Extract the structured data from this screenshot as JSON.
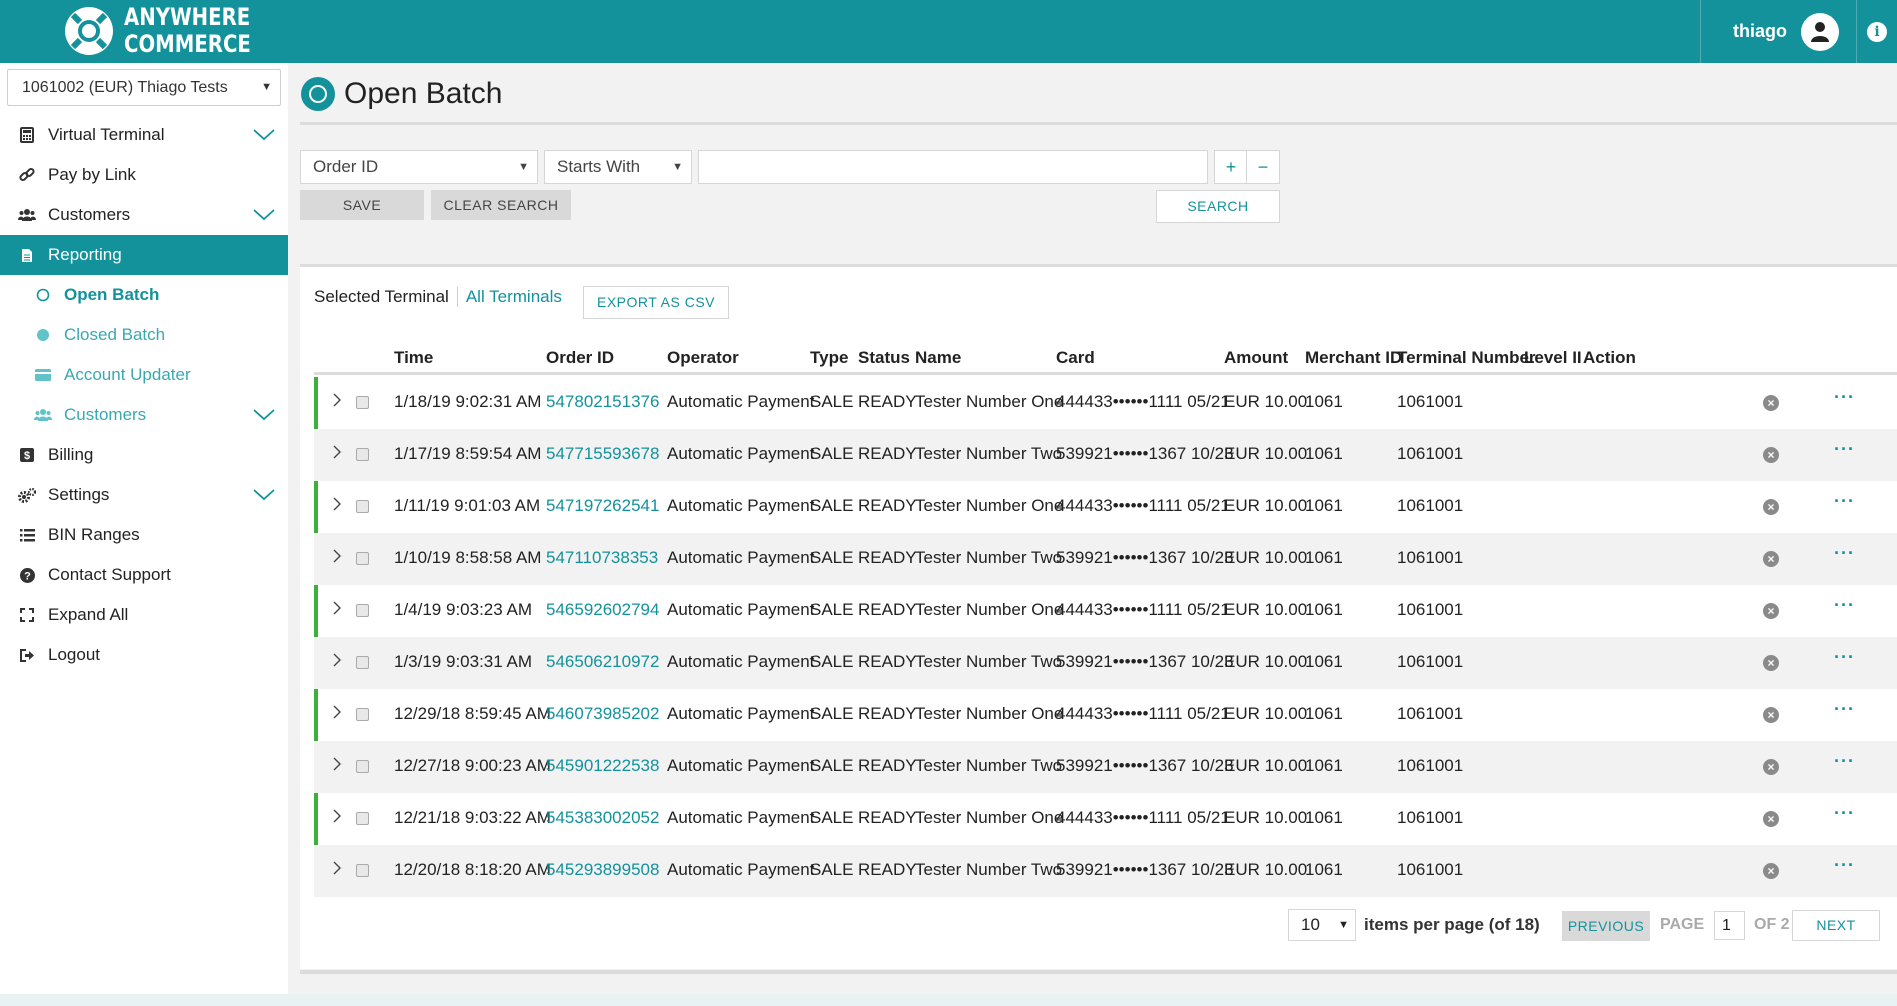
{
  "header": {
    "brand_line1": "ANYWHERE",
    "brand_line2": "COMMERCE",
    "user_name": "thiago",
    "info_icon": "info-icon",
    "colors": {
      "primary": "#13929c"
    }
  },
  "sidebar": {
    "merchant": "1061002 (EUR) Thiago Tests",
    "items": [
      {
        "label": "Virtual Terminal",
        "icon": "calculator-icon"
      },
      {
        "label": "Pay by Link",
        "icon": "link-icon"
      },
      {
        "label": "Customers",
        "icon": "users-icon"
      },
      {
        "label": "Reporting",
        "icon": "document-icon"
      },
      {
        "label": "Open Batch",
        "icon": "circle-outline-icon"
      },
      {
        "label": "Closed Batch",
        "icon": "circle-filled-icon"
      },
      {
        "label": "Account Updater",
        "icon": "credit-card-icon"
      },
      {
        "label": "Customers",
        "icon": "users-icon"
      },
      {
        "label": "Billing",
        "icon": "dollar-icon"
      },
      {
        "label": "Settings",
        "icon": "cogs-icon"
      },
      {
        "label": "BIN Ranges",
        "icon": "list-icon"
      },
      {
        "label": "Contact Support",
        "icon": "question-icon"
      },
      {
        "label": "Expand All",
        "icon": "expand-icon"
      },
      {
        "label": "Logout",
        "icon": "sign-out-icon"
      }
    ]
  },
  "page": {
    "title": "Open Batch"
  },
  "search": {
    "field": "Order ID",
    "operator": "Starts With",
    "value": "",
    "add": "+",
    "remove": "−",
    "save": "SAVE",
    "clear": "CLEAR SEARCH",
    "search": "SEARCH"
  },
  "table": {
    "selected_terminal": "Selected Terminal",
    "all_terminals": "All Terminals",
    "export": "EXPORT AS CSV",
    "headers": [
      "Time",
      "Order ID",
      "Operator",
      "Type",
      "Status",
      "Name",
      "Card",
      "Amount",
      "Merchant ID",
      "Terminal Number",
      "Level II",
      "Action"
    ],
    "rows": [
      {
        "time": "1/18/19 9:02:31 AM",
        "order_id": "547802151376",
        "operator": "Automatic Payment",
        "type": "SALE",
        "status": "READY",
        "name": "Tester Number One",
        "card": "444433••••••1111 05/21",
        "amount": "EUR 10.00",
        "merchant_id": "1061",
        "terminal": "1061001"
      },
      {
        "time": "1/17/19 8:59:54 AM",
        "order_id": "547715593678",
        "operator": "Automatic Payment",
        "type": "SALE",
        "status": "READY",
        "name": "Tester Number Two",
        "card": "539921••••••1367 10/23",
        "amount": "EUR 10.00",
        "merchant_id": "1061",
        "terminal": "1061001"
      },
      {
        "time": "1/11/19 9:01:03 AM",
        "order_id": "547197262541",
        "operator": "Automatic Payment",
        "type": "SALE",
        "status": "READY",
        "name": "Tester Number One",
        "card": "444433••••••1111 05/21",
        "amount": "EUR 10.00",
        "merchant_id": "1061",
        "terminal": "1061001"
      },
      {
        "time": "1/10/19 8:58:58 AM",
        "order_id": "547110738353",
        "operator": "Automatic Payment",
        "type": "SALE",
        "status": "READY",
        "name": "Tester Number Two",
        "card": "539921••••••1367 10/23",
        "amount": "EUR 10.00",
        "merchant_id": "1061",
        "terminal": "1061001"
      },
      {
        "time": "1/4/19 9:03:23 AM",
        "order_id": "546592602794",
        "operator": "Automatic Payment",
        "type": "SALE",
        "status": "READY",
        "name": "Tester Number One",
        "card": "444433••••••1111 05/21",
        "amount": "EUR 10.00",
        "merchant_id": "1061",
        "terminal": "1061001"
      },
      {
        "time": "1/3/19 9:03:31 AM",
        "order_id": "546506210972",
        "operator": "Automatic Payment",
        "type": "SALE",
        "status": "READY",
        "name": "Tester Number Two",
        "card": "539921••••••1367 10/23",
        "amount": "EUR 10.00",
        "merchant_id": "1061",
        "terminal": "1061001"
      },
      {
        "time": "12/29/18 8:59:45 AM",
        "order_id": "546073985202",
        "operator": "Automatic Payment",
        "type": "SALE",
        "status": "READY",
        "name": "Tester Number One",
        "card": "444433••••••1111 05/21",
        "amount": "EUR 10.00",
        "merchant_id": "1061",
        "terminal": "1061001"
      },
      {
        "time": "12/27/18 9:00:23 AM",
        "order_id": "545901222538",
        "operator": "Automatic Payment",
        "type": "SALE",
        "status": "READY",
        "name": "Tester Number Two",
        "card": "539921••••••1367 10/23",
        "amount": "EUR 10.00",
        "merchant_id": "1061",
        "terminal": "1061001"
      },
      {
        "time": "12/21/18 9:03:22 AM",
        "order_id": "545383002052",
        "operator": "Automatic Payment",
        "type": "SALE",
        "status": "READY",
        "name": "Tester Number One",
        "card": "444433••••••1111 05/21",
        "amount": "EUR 10.00",
        "merchant_id": "1061",
        "terminal": "1061001"
      },
      {
        "time": "12/20/18 8:18:20 AM",
        "order_id": "545293899508",
        "operator": "Automatic Payment",
        "type": "SALE",
        "status": "READY",
        "name": "Tester Number Two",
        "card": "539921••••••1367 10/23",
        "amount": "EUR 10.00",
        "merchant_id": "1061",
        "terminal": "1061001"
      }
    ]
  },
  "pager": {
    "per_page": "10",
    "items_text": "items per page (of 18)",
    "previous": "PREVIOUS",
    "page_label": "PAGE",
    "page": "1",
    "of_label": "OF 2",
    "next": "NEXT"
  }
}
